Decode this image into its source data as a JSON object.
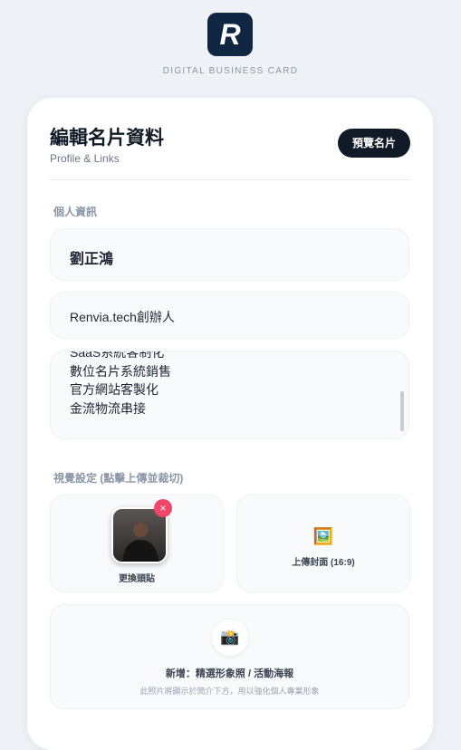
{
  "brand": {
    "logo_letter": "R",
    "subtitle": "DIGITAL BUSINESS CARD",
    "accent_color": "#0f2742"
  },
  "editor": {
    "title": "編輯名片資料",
    "subtitle": "Profile & Links",
    "preview_button": "預覽名片"
  },
  "personal_info": {
    "section_label": "個人資訊",
    "name_value": "劉正鴻",
    "title_value": "Renvia.tech創辦人",
    "bio_lines": [
      "SaaS系統客制化",
      "數位名片系統銷售",
      "官方網站客製化",
      "金流物流串接"
    ]
  },
  "visual_settings": {
    "section_label": "視覺設定 (點擊上傳並裁切)",
    "avatar_caption": "更換頭貼",
    "remove_icon": "×",
    "cover_icon": "🖼️",
    "cover_caption": "上傳封面 (16:9)",
    "add_photo_icon": "📸",
    "add_photo_title": "新增：精選形象照 / 活動海報",
    "add_photo_hint": "此照片將顯示於簡介下方，用以強化個人專業形象",
    "remove_color": "#f0466a"
  }
}
